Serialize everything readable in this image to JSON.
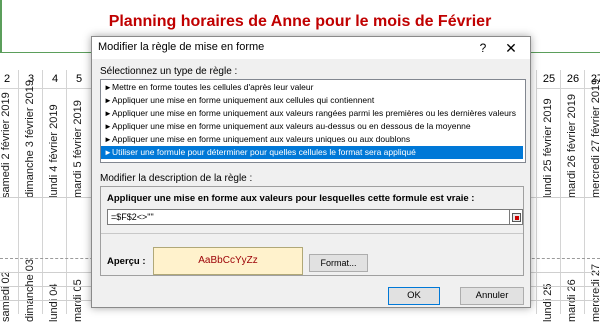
{
  "sheet": {
    "title": "Planning horaires de Anne pour le mois de Février",
    "columns": [
      {
        "num": "2",
        "date": "samedi 2 février 2019",
        "day": "samedi 02"
      },
      {
        "num": "3",
        "date": "dimanche 3 février 2019",
        "day": "dimanche 03"
      },
      {
        "num": "4",
        "date": "lundi 4 février 2019",
        "day": "lundi 04"
      },
      {
        "num": "5",
        "date": "mardi 5 février 2019",
        "day": "mardi 05"
      },
      {
        "num": "25",
        "date": "lundi 25 février 2019",
        "day": "lundi 25"
      },
      {
        "num": "26",
        "date": "mardi 26 février 2019",
        "day": "mardi 26"
      },
      {
        "num": "27",
        "date": "mercredi 27 février 2019",
        "day": "mercredi 27"
      }
    ]
  },
  "dialog": {
    "title": "Modifier la règle de mise en forme",
    "help_label": "?",
    "close_label": "✕",
    "select_type_label": "Sélectionnez un type de règle :",
    "rule_types": [
      {
        "label": "Mettre en forme toutes les cellules d'après leur valeur"
      },
      {
        "label": "Appliquer une mise en forme uniquement aux cellules qui contiennent"
      },
      {
        "label": "Appliquer une mise en forme uniquement aux valeurs rangées parmi les premières ou les dernières valeurs"
      },
      {
        "label": "Appliquer une mise en forme uniquement aux valeurs au-dessus ou en dessous de la moyenne"
      },
      {
        "label": "Appliquer une mise en forme uniquement aux valeurs uniques ou aux doublons"
      },
      {
        "label": "Utiliser une formule pour déterminer pour quelles cellules le format sera appliqué"
      }
    ],
    "selected_rule_index": 5,
    "description_label": "Modifier la description de la règle :",
    "formula_label": "Appliquer une mise en forme aux valeurs pour lesquelles cette formule est vraie :",
    "formula_value": "=$F$2<>\"\"",
    "preview_label": "Aperçu :",
    "preview_text": "AaBbCcYyZz",
    "format_button": "Format...",
    "ok_button": "OK",
    "cancel_button": "Annuler"
  },
  "colors": {
    "title_red": "#c00000",
    "selection_blue": "#0078d7",
    "preview_fill": "#fff2cc",
    "preview_text": "#9c0006"
  }
}
